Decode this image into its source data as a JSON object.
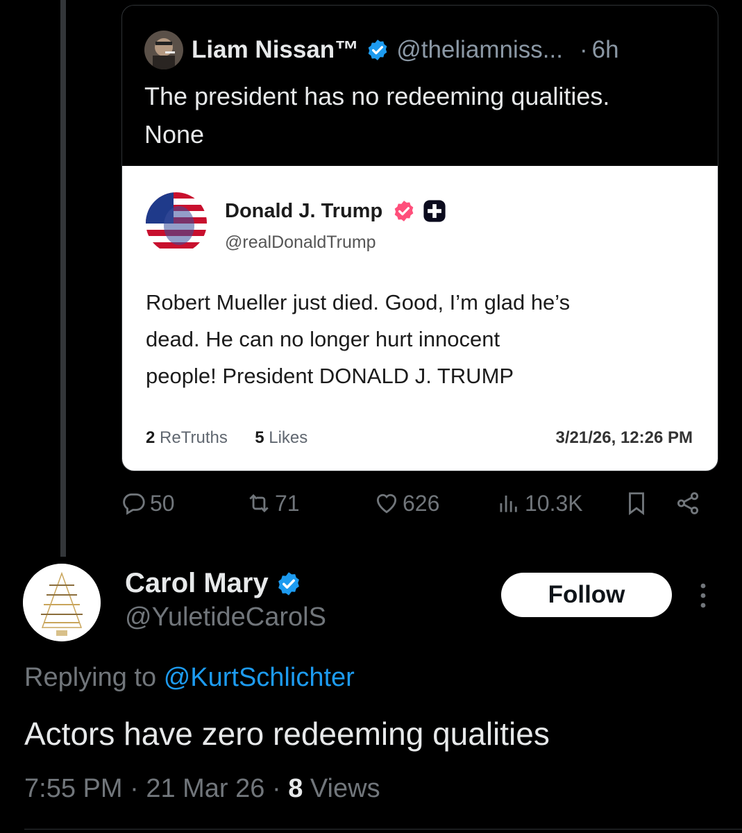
{
  "quoted_tweet": {
    "author_name": "Liam Nissan™",
    "handle": "@theliamniss...",
    "separator": "·",
    "time": "6h",
    "text_line1": "The president has no redeeming qualities.",
    "text_line2": "None",
    "embedded_truth": {
      "author_name": "Donald J. Trump",
      "handle": "@realDonaldTrump",
      "text_line1": "Robert Mueller just died. Good, I’m glad he’s",
      "text_line2": "dead. He can no longer hurt innocent",
      "text_line3": "people! President DONALD J. TRUMP",
      "retruths_count": "2",
      "retruths_label": "ReTruths",
      "likes_count": "5",
      "likes_label": "Likes",
      "datetime": "3/21/26, 12:26 PM"
    }
  },
  "actions": {
    "replies": "50",
    "reposts": "71",
    "likes": "626",
    "views": "10.3K"
  },
  "reply": {
    "author_name": "Carol Mary",
    "handle": "@YuletideCarolS",
    "follow_label": "Follow",
    "replying_prefix": "Replying to",
    "replying_mention": "@KurtSchlichter",
    "text": "Actors have zero redeeming qualities",
    "time": "7:55 PM",
    "date": "21 Mar 26",
    "sep": "·",
    "views_count": "8",
    "views_label": "Views"
  },
  "colors": {
    "background": "#000000",
    "accent_blue": "#1d9bf0",
    "muted_text": "#71767b",
    "truth_verified_pink": "#ff4f7b"
  }
}
